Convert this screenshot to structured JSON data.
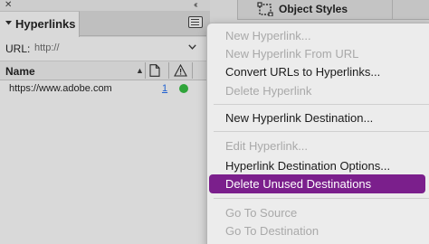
{
  "panel": {
    "tab_title": "Hyperlinks",
    "url_label": "URL:",
    "url_value": "http://",
    "column_name": "Name",
    "sort_glyph": "▲",
    "rows": [
      {
        "name": "https://www.adobe.com",
        "page": "1",
        "status_color": "#2fa43a"
      }
    ]
  },
  "right": {
    "object_styles_label": "Object Styles"
  },
  "menu": {
    "items": [
      {
        "label": "New Hyperlink...",
        "enabled": false
      },
      {
        "label": "New Hyperlink From URL",
        "enabled": false
      },
      {
        "label": "Convert URLs to Hyperlinks...",
        "enabled": true
      },
      {
        "label": "Delete Hyperlink",
        "enabled": false
      },
      {
        "label": "New Hyperlink Destination...",
        "enabled": true
      },
      {
        "label": "Edit Hyperlink...",
        "enabled": false
      },
      {
        "label": "Hyperlink Destination Options...",
        "enabled": true
      },
      {
        "label": "Delete Unused Destinations",
        "enabled": true,
        "highlighted": true
      },
      {
        "label": "Go To Source",
        "enabled": false
      },
      {
        "label": "Go To Destination",
        "enabled": false
      }
    ],
    "highlight_color": "#7b1f8c"
  },
  "icons": {
    "close": "close-icon",
    "collapse": "double-chevron-left-icon",
    "panel_menu": "panel-menu-icon",
    "page": "page-icon",
    "warning": "warning-icon",
    "object_styles": "object-styles-icon"
  }
}
